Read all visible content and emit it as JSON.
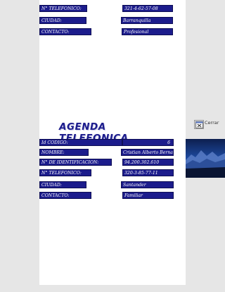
{
  "app_title": "AGENDA TELEFONICA",
  "close_button": {
    "label": "Cerrar",
    "icon": "close-window-icon"
  },
  "record_top": {
    "telefono_label": "N° TELEFONICO:",
    "telefono_value": "321-4-62-57-08",
    "ciudad_label": "CIUDAD:",
    "ciudad_value": "Barranquilla",
    "contacto_label": "CONTACTO:",
    "contacto_value": "Profesional"
  },
  "record_main": {
    "codigo_label": "Id CODIGO:",
    "codigo_value": "6",
    "nombre_label": "NOMBRE:",
    "nombre_value": "Cristian Alberto Bernal",
    "identificacion_label": "N° DE IDENTIFICACION:",
    "identificacion_value": "94.200.302.610",
    "telefono_label": "N° TELEFONICO:",
    "telefono_value": "320-3-85-77-11",
    "ciudad_label": "CIUDAD:",
    "ciudad_value": "Santander",
    "contacto_label": "CONTACTO:",
    "contacto_value": "Familiar"
  },
  "colors": {
    "cell_bg": "#1c1c8c",
    "title": "#1c1c8c",
    "page_bg": "#e6e6e6"
  }
}
